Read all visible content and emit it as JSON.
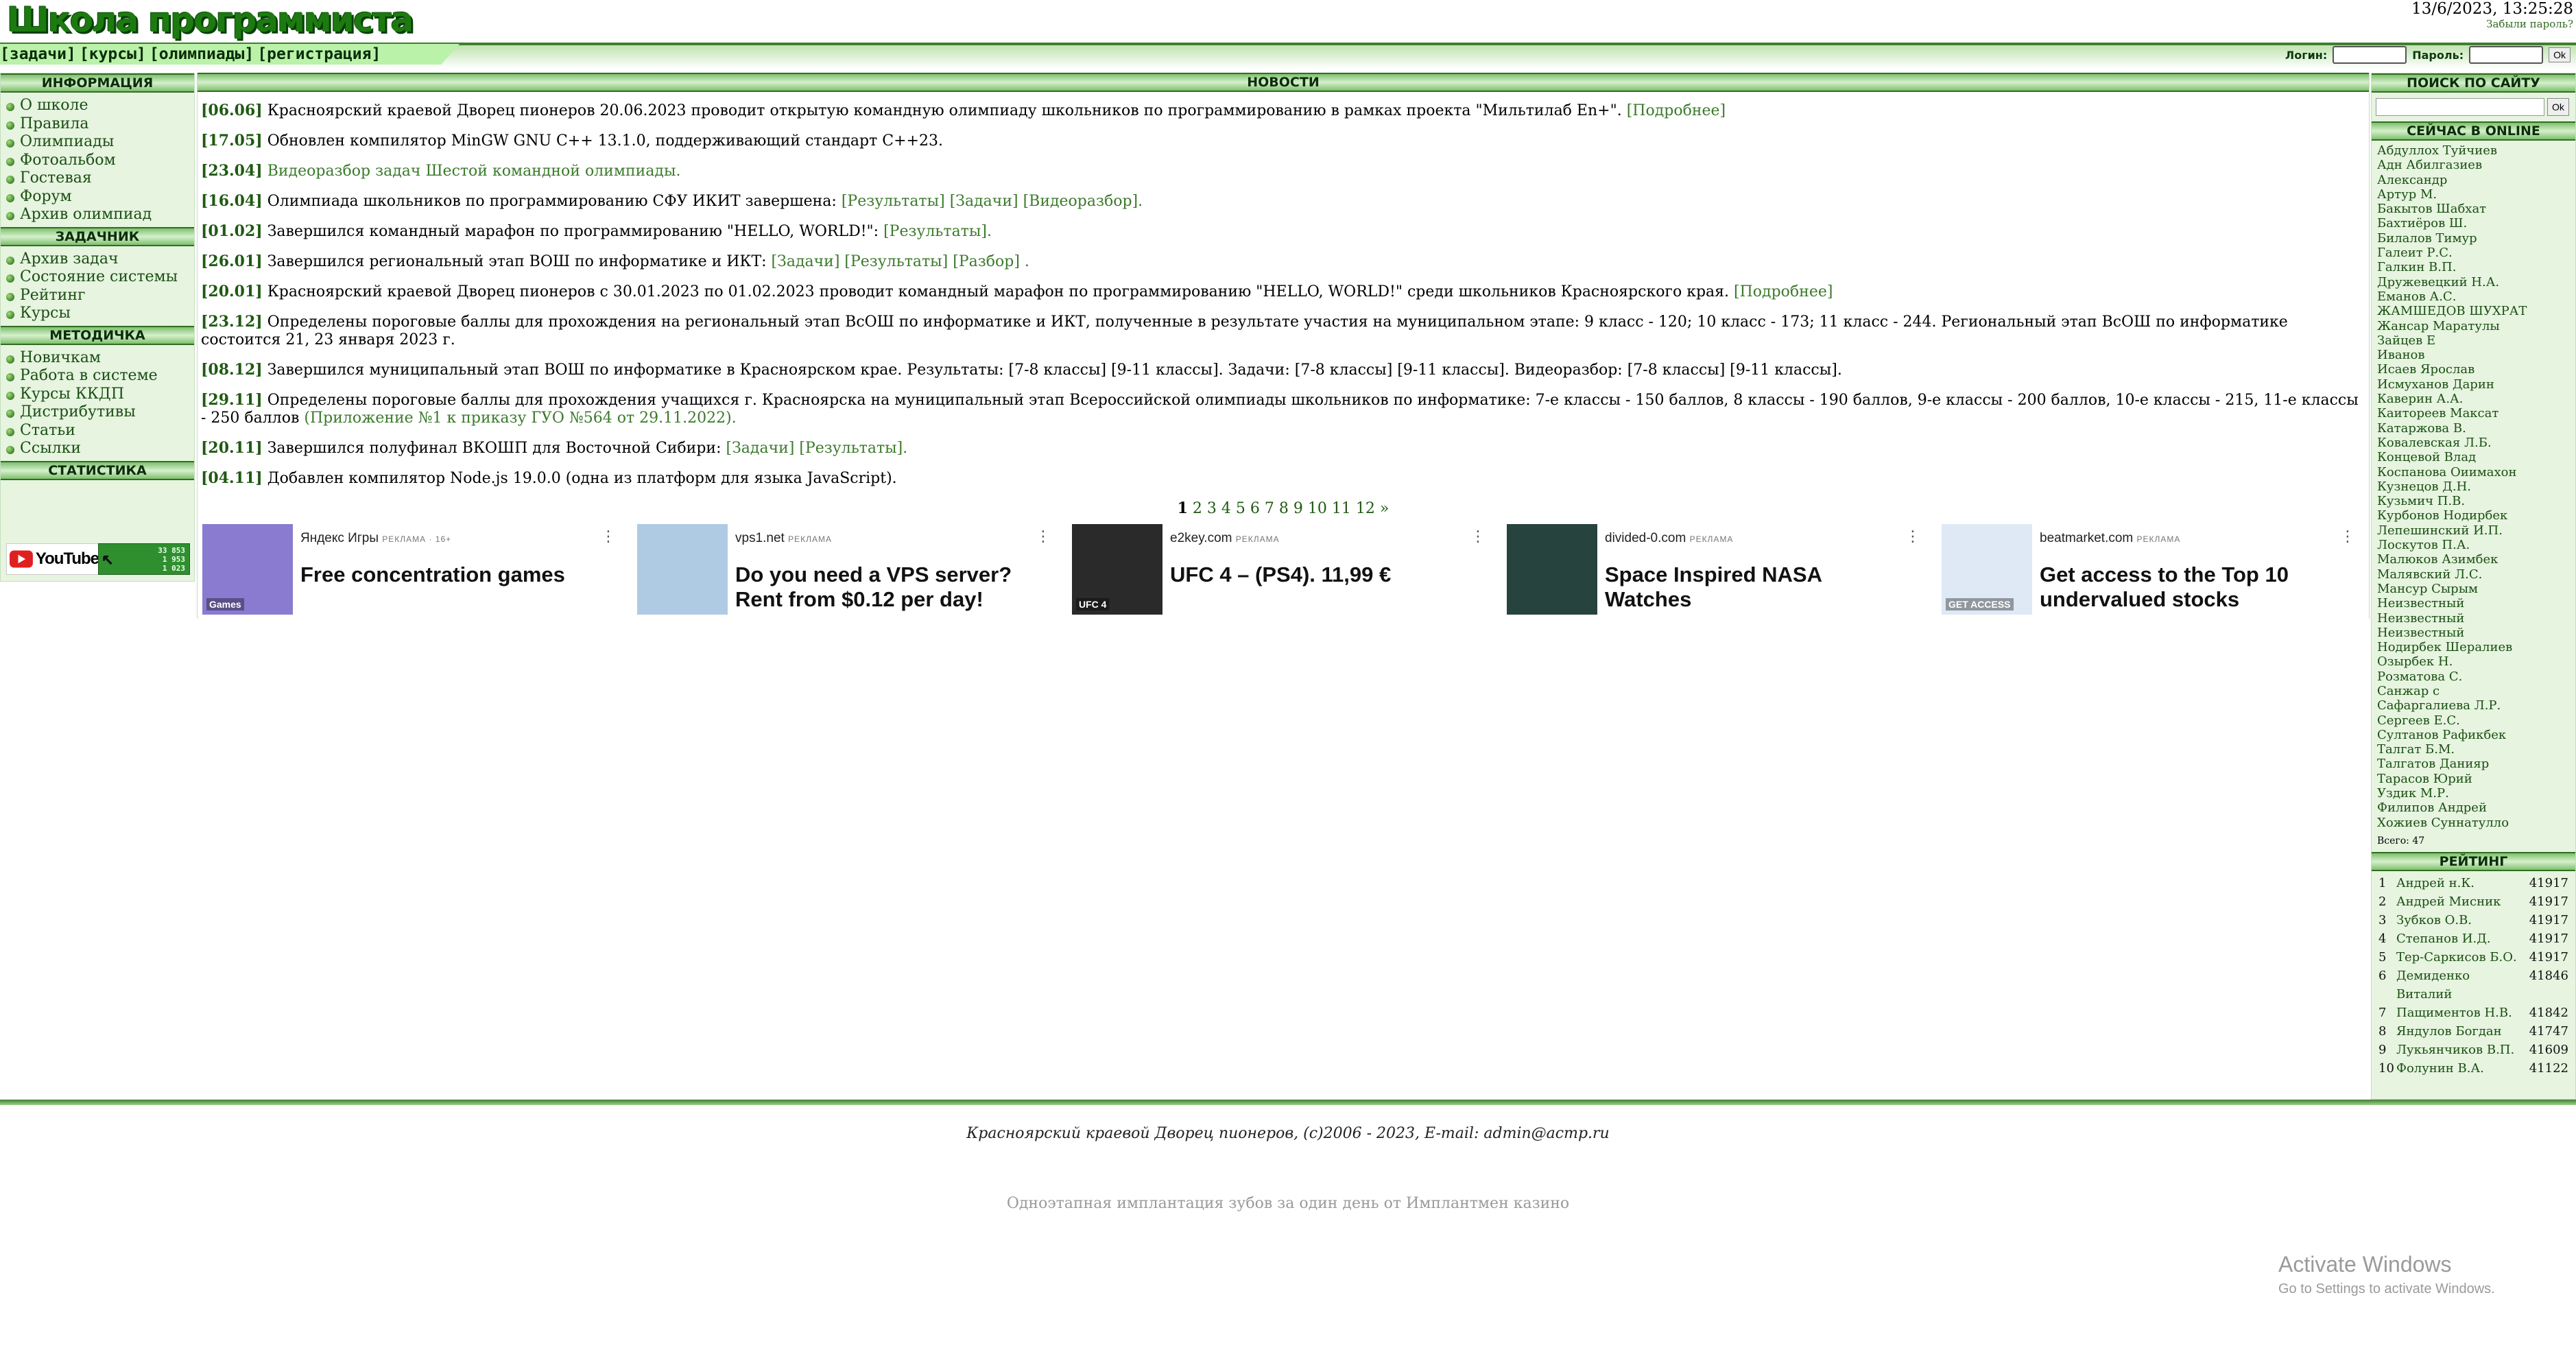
{
  "header": {
    "logo": "Школа программиста",
    "datetime": "13/6/2023, 13:25:28",
    "forgot_password": "Забыли пароль?"
  },
  "topmenu": [
    "[задачи]",
    "[курсы]",
    "[олимпиады]",
    "[регистрация]"
  ],
  "login": {
    "login_label": "Логин:",
    "password_label": "Пароль:",
    "ok": "Ok"
  },
  "left": {
    "info_title": "ИНФОРМАЦИЯ",
    "info_items": [
      "О школе",
      "Правила",
      "Олимпиады",
      "Фотоальбом",
      "Гостевая",
      "Форум",
      "Архив олимпиад"
    ],
    "tasks_title": "ЗАДАЧНИК",
    "tasks_items": [
      "Архив задач",
      "Состояние системы",
      "Рейтинг",
      "Курсы"
    ],
    "method_title": "МЕТОДИЧКА",
    "method_items": [
      "Новичкам",
      "Работа в системе",
      "Курсы ККДП",
      "Дистрибутивы",
      "Статьи",
      "Ссылки"
    ],
    "stats_title": "СТАТИСТИКА",
    "youtube": "YouTube",
    "counter": [
      "33 853",
      "1 953",
      "1 023"
    ]
  },
  "news": {
    "title": "НОВОСТИ",
    "items": [
      {
        "date": "[06.06]",
        "text": "Красноярский краевой Дворец пионеров 20.06.2023 проводит открытую командную олимпиаду школьников по программированию в рамках проекта \"Мильтилаб En+\".",
        "links": [
          "[Подробнее]"
        ]
      },
      {
        "date": "[17.05]",
        "text": "Обновлен компилятор MinGW GNU C++ 13.1.0, поддерживающий стандарт C++23.",
        "links": []
      },
      {
        "date": "[23.04]",
        "text": "",
        "links": [
          "Видеоразбор задач Шестой командной олимпиады."
        ]
      },
      {
        "date": "[16.04]",
        "text": "Олимпиада школьников по программированию СФУ ИКИТ завершена:",
        "links": [
          "[Результаты]",
          "[Задачи]",
          "[Видеоразбор]."
        ]
      },
      {
        "date": "[01.02]",
        "text": "Завершился командный марафон по программированию \"HELLO, WORLD!\":",
        "links": [
          "[Результаты]."
        ]
      },
      {
        "date": "[26.01]",
        "text": "Завершился региональный этап ВОШ по информатике и ИКТ:",
        "links": [
          "[Задачи]",
          "[Результаты]",
          "[Разбор] ."
        ]
      },
      {
        "date": "[20.01]",
        "text": "Красноярский краевой Дворец пионеров с 30.01.2023 по 01.02.2023 проводит командный марафон по программированию \"HELLO, WORLD!\" среди школьников Красноярского края.",
        "links": [
          "[Подробнее]"
        ]
      },
      {
        "date": "[23.12]",
        "text": "Определены пороговые баллы для прохождения на региональный этап ВсОШ по информатике и ИКТ, полученные в результате участия на муниципальном этапе: 9 класс - 120; 10 класс - 173; 11 класс - 244. Региональный этап ВсОШ по информатике состоится 21, 23 января 2023 г.",
        "links": []
      },
      {
        "date": "[08.12]",
        "text": "Завершился муниципальный этап ВОШ по информатике в Красноярском крае. Результаты: [7-8 классы] [9-11 классы]. Задачи: [7-8 классы] [9-11 классы]. Видеоразбор: [7-8 классы] [9-11 классы].",
        "links": []
      },
      {
        "date": "[29.11]",
        "text": "Определены пороговые баллы для прохождения учащихся г. Красноярска на муниципальный этап Всероссийской олимпиады школьников по информатике: 7-е классы - 150 баллов, 8 классы - 190 баллов, 9-е классы - 200 баллов, 10-е классы - 215, 11-е классы - 250 баллов",
        "links": [
          "(Приложение №1 к приказу ГУО №564 от 29.11.2022)."
        ]
      },
      {
        "date": "[20.11]",
        "text": "Завершился полуфинал ВКОШП для Восточной Сибири:",
        "links": [
          "[Задачи]",
          "[Результаты]."
        ]
      },
      {
        "date": "[04.11]",
        "text": "Добавлен компилятор Node.js 19.0.0 (одна из платформ для языка JavaScript).",
        "links": []
      }
    ],
    "pages": [
      "1",
      "2",
      "3",
      "4",
      "5",
      "6",
      "7",
      "8",
      "9",
      "10",
      "11",
      "12",
      "»"
    ]
  },
  "ads": [
    {
      "source": "Яндекс Игры",
      "tag": "РЕКЛАМА · 16+",
      "title": "Free concentration games",
      "thumb_label": "Games",
      "color": "#8a7bd0"
    },
    {
      "source": "vps1.net",
      "tag": "РЕКЛАМА",
      "title": "Do you need a VPS server? Rent from $0.12 per day!",
      "thumb_label": "",
      "color": "#aecbe3"
    },
    {
      "source": "e2key.com",
      "tag": "РЕКЛАМА",
      "title": "UFC 4 – (PS4). 11,99 €",
      "thumb_label": "UFC 4",
      "color": "#2a2a2a"
    },
    {
      "source": "divided-0.com",
      "tag": "РЕКЛАМА",
      "title": "Space Inspired NASA Watches",
      "thumb_label": "",
      "color": "#27433d"
    },
    {
      "source": "beatmarket.com",
      "tag": "РЕКЛАМА",
      "title": "Get access to the Top 10 undervalued stocks",
      "thumb_label": "GET ACCESS",
      "color": "#dfe9f5"
    }
  ],
  "right": {
    "search_title": "ПОИСК ПО САЙТУ",
    "search_ok": "Ok",
    "online_title": "СЕЙЧАС В ONLINE",
    "online": [
      "Абдуллох Туйчиев",
      "Адн Абилгазиев",
      "Александр",
      "Артур М.",
      "Бакытов Шабхат",
      "Бахтиёров Ш.",
      "Билалов Тимур",
      "Галеит Р.С.",
      "Галкин В.П.",
      "Дружевецкий Н.А.",
      "Еманов А.С.",
      "ЖАМШЕДОВ ШУХРАТ",
      "Жансар Маратулы",
      "Зайцев Е",
      "Иванов",
      "Исаев Ярослав",
      "Исмуханов Дарин",
      "Каверин А.А.",
      "Каитореев Максат",
      "Катаржова В.",
      "Ковалевская Л.Б.",
      "Концевой Влад",
      "Коспанова Оиимахон",
      "Кузнецов Д.Н.",
      "Кузьмич П.В.",
      "Курбонов Нодирбек",
      "Лепешинский И.П.",
      "Лоскутов П.А.",
      "Малюков Азимбек",
      "Малявский Л.С.",
      "Мансур Сырым",
      "Неизвестный",
      "Неизвестный",
      "Неизвестный",
      "Нодирбек Шералиев",
      "Озырбек Н.",
      "Розматова С.",
      "Санжар с",
      "Сафаргалиева Л.Р.",
      "Сергеев Е.С.",
      "Султанов Рафикбек",
      "Талгат Б.М.",
      "Талгатов Данияр",
      "Тарасов Юрий",
      "Уздик М.Р.",
      "Филипов Андрей",
      "Хожиев Суннатулло"
    ],
    "total": "Всего: 47",
    "rating_title": "РЕЙТИНГ",
    "rating": [
      {
        "n": "1",
        "name": "Андрей н.К.",
        "score": "41917"
      },
      {
        "n": "2",
        "name": "Андрей Мисник",
        "score": "41917"
      },
      {
        "n": "3",
        "name": "Зубков О.В.",
        "score": "41917"
      },
      {
        "n": "4",
        "name": "Степанов И.Д.",
        "score": "41917"
      },
      {
        "n": "5",
        "name": "Тер-Саркисов Б.О.",
        "score": "41917"
      },
      {
        "n": "6",
        "name": "Демиденко Виталий",
        "score": "41846"
      },
      {
        "n": "7",
        "name": "Пащиментов Н.В.",
        "score": "41842"
      },
      {
        "n": "8",
        "name": "Яндулов Богдан",
        "score": "41747"
      },
      {
        "n": "9",
        "name": "Лукьянчиков В.П.",
        "score": "41609"
      },
      {
        "n": "10",
        "name": "Фолунин В.А.",
        "score": "41122"
      }
    ]
  },
  "footer": {
    "text": "Красноярский краевой Дворец пионеров, (c)2006 - 2023, E-mail: admin@acmp.ru",
    "ad_line": "Одноэтапная имплантация зубов за один день от Имплантмен   казино"
  },
  "watermark": {
    "line1": "Activate Windows",
    "line2": "Go to Settings to activate Windows."
  }
}
